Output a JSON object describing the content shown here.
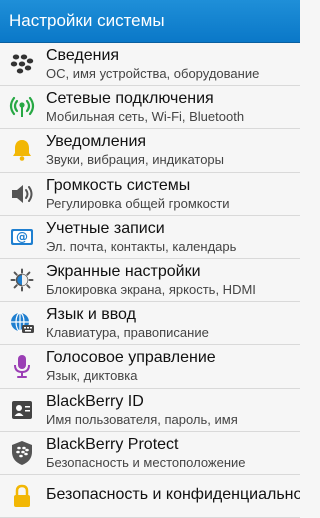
{
  "header": {
    "title": "Настройки системы"
  },
  "items": [
    {
      "icon": "blackberry-logo-icon",
      "title": "Сведения",
      "subtitle": "ОС, имя устройства, оборудование"
    },
    {
      "icon": "network-signal-icon",
      "title": "Сетевые подключения",
      "subtitle": "Мобильная сеть, Wi-Fi, Bluetooth"
    },
    {
      "icon": "bell-icon",
      "title": "Уведомления",
      "subtitle": "Звуки, вибрация, индикаторы"
    },
    {
      "icon": "speaker-icon",
      "title": "Громкость системы",
      "subtitle": "Регулировка общей громкости"
    },
    {
      "icon": "account-icon",
      "title": "Учетные записи",
      "subtitle": "Эл. почта, контакты, календарь"
    },
    {
      "icon": "display-settings-icon",
      "title": "Экранные настройки",
      "subtitle": "Блокировка экрана, яркость, HDMI"
    },
    {
      "icon": "language-globe-icon",
      "title": "Язык и ввод",
      "subtitle": "Клавиатура, правописание"
    },
    {
      "icon": "microphone-icon",
      "title": "Голосовое управление",
      "subtitle": "Язык, диктовка"
    },
    {
      "icon": "id-card-icon",
      "title": "BlackBerry ID",
      "subtitle": "Имя пользователя, пароль, имя"
    },
    {
      "icon": "shield-icon",
      "title": "BlackBerry Protect",
      "subtitle": "Безопасность и местоположение"
    },
    {
      "icon": "lock-icon",
      "title": "Безопасность и конфиденциальность",
      "subtitle": ""
    }
  ]
}
